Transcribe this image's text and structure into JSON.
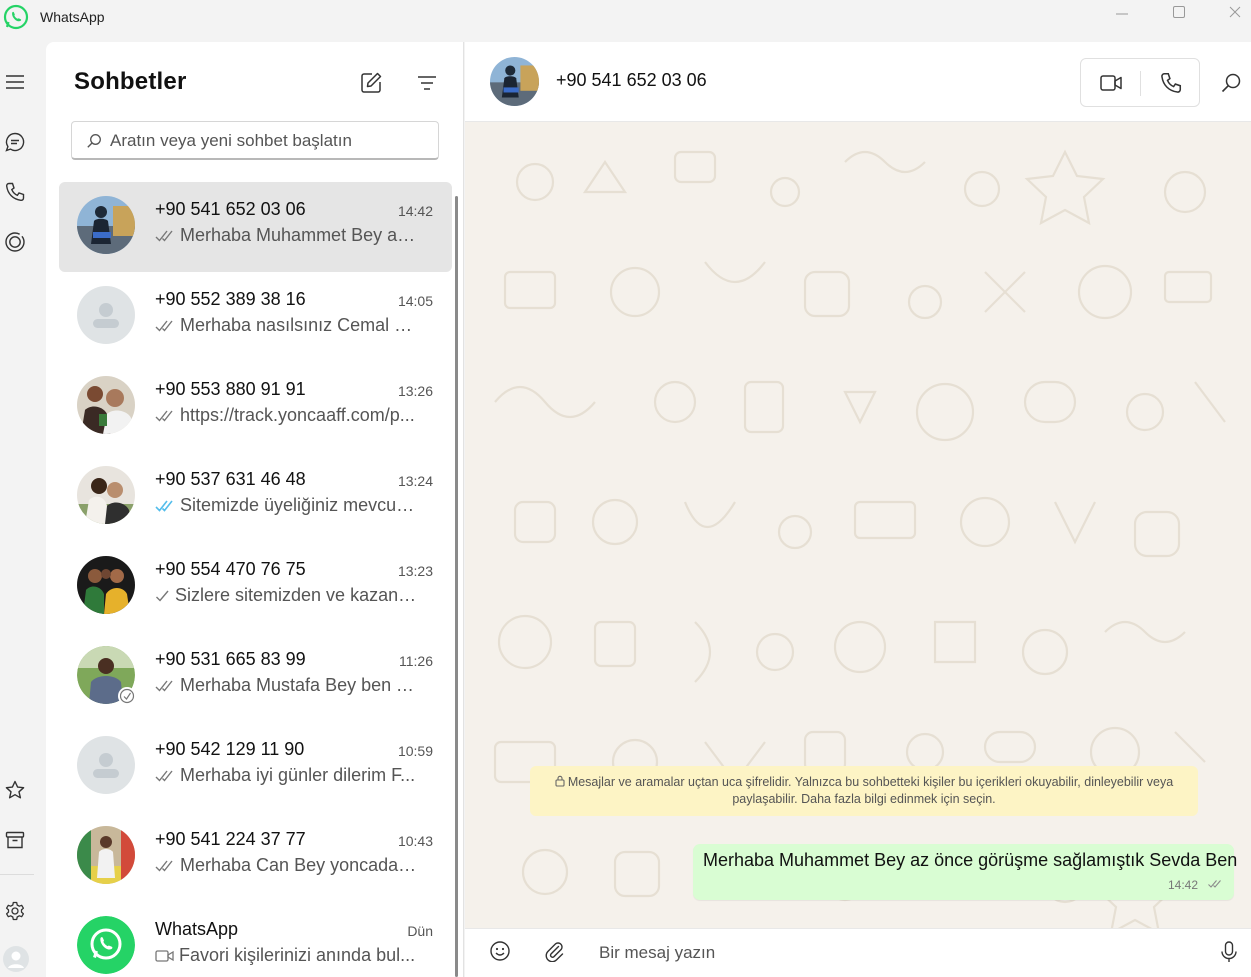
{
  "window": {
    "title": "WhatsApp"
  },
  "colors": {
    "accent": "#25d366",
    "read_tick": "#53bdeb",
    "outgoing_bubble": "#d9fdd3",
    "notice": "#fdf4c5",
    "wallpaper": "#f5f1eb"
  },
  "rail": {
    "top_icons": [
      "menu-icon",
      "chats-icon",
      "calls-icon",
      "status-icon"
    ],
    "bottom_icons": [
      "starred-icon",
      "archive-icon",
      "settings-icon",
      "profile-icon"
    ]
  },
  "sidebar": {
    "title": "Sohbetler",
    "search_placeholder": "Aratın veya yeni sohbet başlatın",
    "chats": [
      {
        "name": "+90 541 652 03 06",
        "time": "14:42",
        "preview": "Merhaba Muhammet Bey az...",
        "tick": "double-grey",
        "active": true
      },
      {
        "name": "+90 552 389 38 16",
        "time": "14:05",
        "preview": "Merhaba nasılsınız Cemal Be...",
        "tick": "double-grey"
      },
      {
        "name": "+90 553 880 91 91",
        "time": "13:26",
        "preview": "https://track.yoncaaff.com/p...",
        "tick": "double-grey"
      },
      {
        "name": "+90 537 631 46 48",
        "time": "13:24",
        "preview": "Sitemizde üyeliğiniz mevcutt...",
        "tick": "double-blue"
      },
      {
        "name": "+90 554 470 76 75",
        "time": "13:23",
        "preview": "Sizlere sitemizden ve kazanç...",
        "tick": "single"
      },
      {
        "name": "+90 531 665 83 99",
        "time": "11:26",
        "preview": "Merhaba Mustafa Bey ben Y...",
        "tick": "double-grey"
      },
      {
        "name": "+90 542 129 11 90",
        "time": "10:59",
        "preview": "Merhaba iyi günler dilerim F...",
        "tick": "double-grey"
      },
      {
        "name": "+90 541 224 37 77",
        "time": "10:43",
        "preview": "Merhaba Can Bey yoncadan...",
        "tick": "double-grey"
      },
      {
        "name": "WhatsApp",
        "time": "Dün",
        "preview": "Favori kişilerinizi anında bul...",
        "tick": "video"
      }
    ]
  },
  "conversation": {
    "contact_name": "+90 541 652 03 06",
    "encryption_notice": "Mesajlar ve aramalar uçtan uca şifrelidir. Yalnızca bu sohbetteki kişiler bu içerikleri okuyabilir, dinleyebilir veya paylaşabilir. Daha fazla bilgi edinmek için seçin.",
    "messages": [
      {
        "direction": "outgoing",
        "text": "Merhaba Muhammet Bey az önce görüşme sağlamıştık Sevda Ben",
        "time": "14:42",
        "status": "delivered"
      }
    ],
    "composer_placeholder": "Bir mesaj yazın"
  }
}
